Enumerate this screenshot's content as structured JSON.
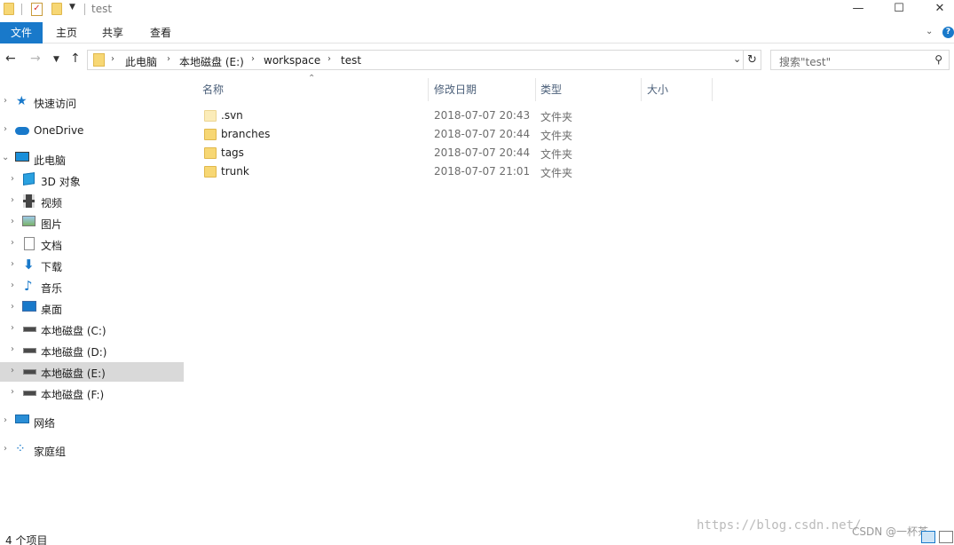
{
  "window": {
    "title": "test",
    "minimize": "—",
    "maximize": "☐",
    "close": "✕"
  },
  "ribbon": {
    "tabs": [
      "文件",
      "主页",
      "共享",
      "查看"
    ]
  },
  "address": {
    "crumbs": [
      "此电脑",
      "本地磁盘 (E:)",
      "workspace",
      "test"
    ]
  },
  "search": {
    "placeholder": "搜索\"test\""
  },
  "sidebar": {
    "items": [
      {
        "label": "快速访问",
        "icon": "star-icon"
      },
      {
        "label": "OneDrive",
        "icon": "cloud-icon"
      },
      {
        "label": "此电脑",
        "icon": "computer-icon"
      },
      {
        "label": "3D 对象",
        "icon": "cube-icon"
      },
      {
        "label": "视频",
        "icon": "video-icon"
      },
      {
        "label": "图片",
        "icon": "picture-icon"
      },
      {
        "label": "文档",
        "icon": "document-icon"
      },
      {
        "label": "下载",
        "icon": "download-icon"
      },
      {
        "label": "音乐",
        "icon": "music-icon"
      },
      {
        "label": "桌面",
        "icon": "desktop-icon"
      },
      {
        "label": "本地磁盘 (C:)",
        "icon": "drive-icon"
      },
      {
        "label": "本地磁盘 (D:)",
        "icon": "drive-icon"
      },
      {
        "label": "本地磁盘 (E:)",
        "icon": "drive-icon"
      },
      {
        "label": "本地磁盘 (F:)",
        "icon": "drive-icon"
      },
      {
        "label": "网络",
        "icon": "network-icon"
      },
      {
        "label": "家庭组",
        "icon": "homegroup-icon"
      }
    ]
  },
  "columns": {
    "name": "名称",
    "date": "修改日期",
    "type": "类型",
    "size": "大小"
  },
  "files": [
    {
      "name": ".svn",
      "date": "2018-07-07 20:43",
      "type": "文件夹"
    },
    {
      "name": "branches",
      "date": "2018-07-07 20:44",
      "type": "文件夹"
    },
    {
      "name": "tags",
      "date": "2018-07-07 20:44",
      "type": "文件夹"
    },
    {
      "name": "trunk",
      "date": "2018-07-07 21:01",
      "type": "文件夹"
    }
  ],
  "status": {
    "count": "4 个项目"
  },
  "watermark": {
    "url": "https://blog.csdn.net/",
    "author": "CSDN @一杯茶"
  },
  "colors": {
    "accent": "#1979ca",
    "folder": "#f7d774",
    "selected": "#d9d9d9"
  }
}
